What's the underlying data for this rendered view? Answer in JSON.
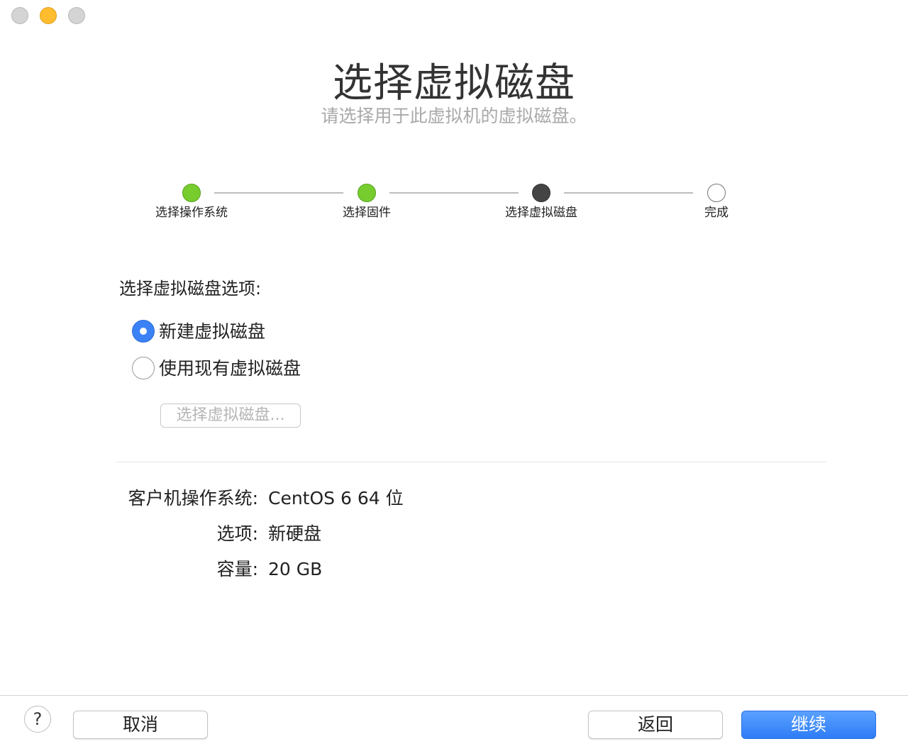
{
  "window": {
    "title": "选择虚拟磁盘",
    "subtitle": "请选择用于此虚拟机的虚拟磁盘。"
  },
  "steps": [
    {
      "label": "选择操作系统",
      "status": "done"
    },
    {
      "label": "选择固件",
      "status": "done"
    },
    {
      "label": "选择虚拟磁盘",
      "status": "current"
    },
    {
      "label": "完成",
      "status": "todo"
    }
  ],
  "disk_options": {
    "heading": "选择虚拟磁盘选项:",
    "radios": [
      {
        "label": "新建虚拟磁盘",
        "selected": true
      },
      {
        "label": "使用现有虚拟磁盘",
        "selected": false
      }
    ],
    "choose_button": "选择虚拟磁盘..."
  },
  "summary": {
    "os_key": "客户机操作系统:",
    "os_value": "CentOS 6 64 位",
    "option_key": "选项:",
    "option_value": "新硬盘",
    "capacity_key": "容量:",
    "capacity_value": "20 GB"
  },
  "footer": {
    "help": "?",
    "cancel": "取消",
    "back": "返回",
    "continue": "继续"
  },
  "colors": {
    "step_done": "#77cd2e",
    "step_current": "#444444",
    "accent": "#2e7cf6"
  }
}
